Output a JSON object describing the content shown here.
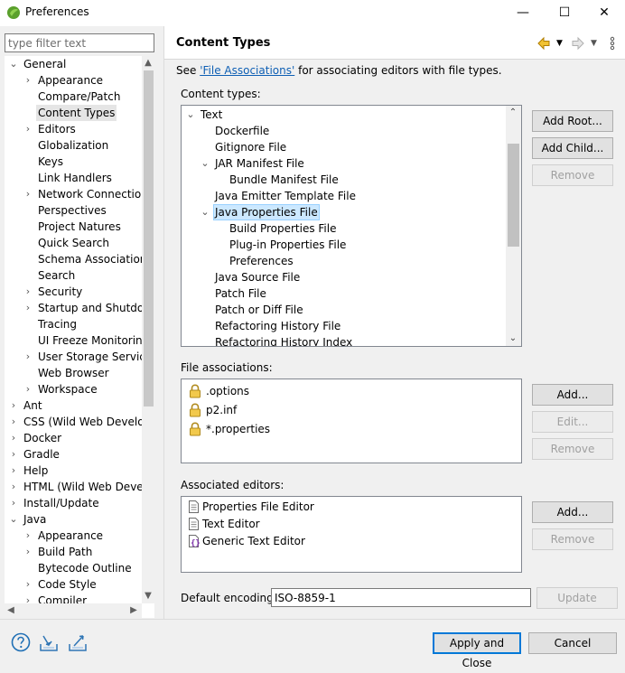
{
  "window": {
    "title": "Preferences",
    "minimize": "—",
    "maximize": "☐",
    "close": "✕"
  },
  "left": {
    "filter_placeholder": "type filter text",
    "tree": [
      {
        "label": "General",
        "level": 0,
        "toggle": "⌄"
      },
      {
        "label": "Appearance",
        "level": 1,
        "toggle": "›"
      },
      {
        "label": "Compare/Patch",
        "level": 1,
        "toggle": ""
      },
      {
        "label": "Content Types",
        "level": 1,
        "toggle": "",
        "selected": true
      },
      {
        "label": "Editors",
        "level": 1,
        "toggle": "›"
      },
      {
        "label": "Globalization",
        "level": 1,
        "toggle": ""
      },
      {
        "label": "Keys",
        "level": 1,
        "toggle": ""
      },
      {
        "label": "Link Handlers",
        "level": 1,
        "toggle": ""
      },
      {
        "label": "Network Connection",
        "level": 1,
        "toggle": "›"
      },
      {
        "label": "Perspectives",
        "level": 1,
        "toggle": ""
      },
      {
        "label": "Project Natures",
        "level": 1,
        "toggle": ""
      },
      {
        "label": "Quick Search",
        "level": 1,
        "toggle": ""
      },
      {
        "label": "Schema Associations",
        "level": 1,
        "toggle": ""
      },
      {
        "label": "Search",
        "level": 1,
        "toggle": ""
      },
      {
        "label": "Security",
        "level": 1,
        "toggle": "›"
      },
      {
        "label": "Startup and Shutdow",
        "level": 1,
        "toggle": "›"
      },
      {
        "label": "Tracing",
        "level": 1,
        "toggle": ""
      },
      {
        "label": "UI Freeze Monitoring",
        "level": 1,
        "toggle": ""
      },
      {
        "label": "User Storage Service",
        "level": 1,
        "toggle": "›"
      },
      {
        "label": "Web Browser",
        "level": 1,
        "toggle": ""
      },
      {
        "label": "Workspace",
        "level": 1,
        "toggle": "›"
      },
      {
        "label": "Ant",
        "level": 0,
        "toggle": "›"
      },
      {
        "label": "CSS (Wild Web Develop",
        "level": 0,
        "toggle": "›"
      },
      {
        "label": "Docker",
        "level": 0,
        "toggle": "›"
      },
      {
        "label": "Gradle",
        "level": 0,
        "toggle": "›"
      },
      {
        "label": "Help",
        "level": 0,
        "toggle": "›"
      },
      {
        "label": "HTML (Wild Web Develo",
        "level": 0,
        "toggle": "›"
      },
      {
        "label": "Install/Update",
        "level": 0,
        "toggle": "›"
      },
      {
        "label": "Java",
        "level": 0,
        "toggle": "⌄"
      },
      {
        "label": "Appearance",
        "level": 1,
        "toggle": "›"
      },
      {
        "label": "Build Path",
        "level": 1,
        "toggle": "›"
      },
      {
        "label": "Bytecode Outline",
        "level": 1,
        "toggle": ""
      },
      {
        "label": "Code Style",
        "level": 1,
        "toggle": "›"
      },
      {
        "label": "Compiler",
        "level": 1,
        "toggle": "›"
      }
    ]
  },
  "right": {
    "title": "Content Types",
    "see_prefix": "See ",
    "see_link": "'File Associations'",
    "see_suffix": " for associating editors with file types.",
    "content_types_label": "Content types:",
    "content_types": [
      {
        "label": "Text",
        "level": 0,
        "toggle": "⌄"
      },
      {
        "label": "Dockerfile",
        "level": 1,
        "toggle": ""
      },
      {
        "label": "Gitignore File",
        "level": 1,
        "toggle": ""
      },
      {
        "label": "JAR Manifest File",
        "level": 1,
        "toggle": "⌄"
      },
      {
        "label": "Bundle Manifest File",
        "level": 2,
        "toggle": ""
      },
      {
        "label": "Java Emitter Template File",
        "level": 1,
        "toggle": ""
      },
      {
        "label": "Java Properties File",
        "level": 1,
        "toggle": "⌄",
        "selected": true
      },
      {
        "label": "Build Properties File",
        "level": 2,
        "toggle": ""
      },
      {
        "label": "Plug-in Properties File",
        "level": 2,
        "toggle": ""
      },
      {
        "label": "Preferences",
        "level": 2,
        "toggle": ""
      },
      {
        "label": "Java Source File",
        "level": 1,
        "toggle": ""
      },
      {
        "label": "Patch File",
        "level": 1,
        "toggle": ""
      },
      {
        "label": "Patch or Diff File",
        "level": 1,
        "toggle": ""
      },
      {
        "label": "Refactoring History File",
        "level": 1,
        "toggle": ""
      },
      {
        "label": "Refactoring History Index",
        "level": 1,
        "toggle": ""
      }
    ],
    "ct_buttons": {
      "add_root": "Add Root...",
      "add_child": "Add Child...",
      "remove": "Remove"
    },
    "file_assoc_label": "File associations:",
    "file_associations": [
      ".options",
      "p2.inf",
      "*.properties"
    ],
    "fa_buttons": {
      "add": "Add...",
      "edit": "Edit...",
      "remove": "Remove"
    },
    "assoc_editors_label": "Associated editors:",
    "associated_editors": [
      "Properties File Editor",
      "Text Editor",
      "Generic Text Editor"
    ],
    "ae_buttons": {
      "add": "Add...",
      "remove": "Remove"
    },
    "encoding_label": "Default encoding:",
    "encoding_value": "ISO-8859-1",
    "update_button": "Update"
  },
  "bottom": {
    "apply_close": "Apply and Close",
    "cancel": "Cancel"
  }
}
